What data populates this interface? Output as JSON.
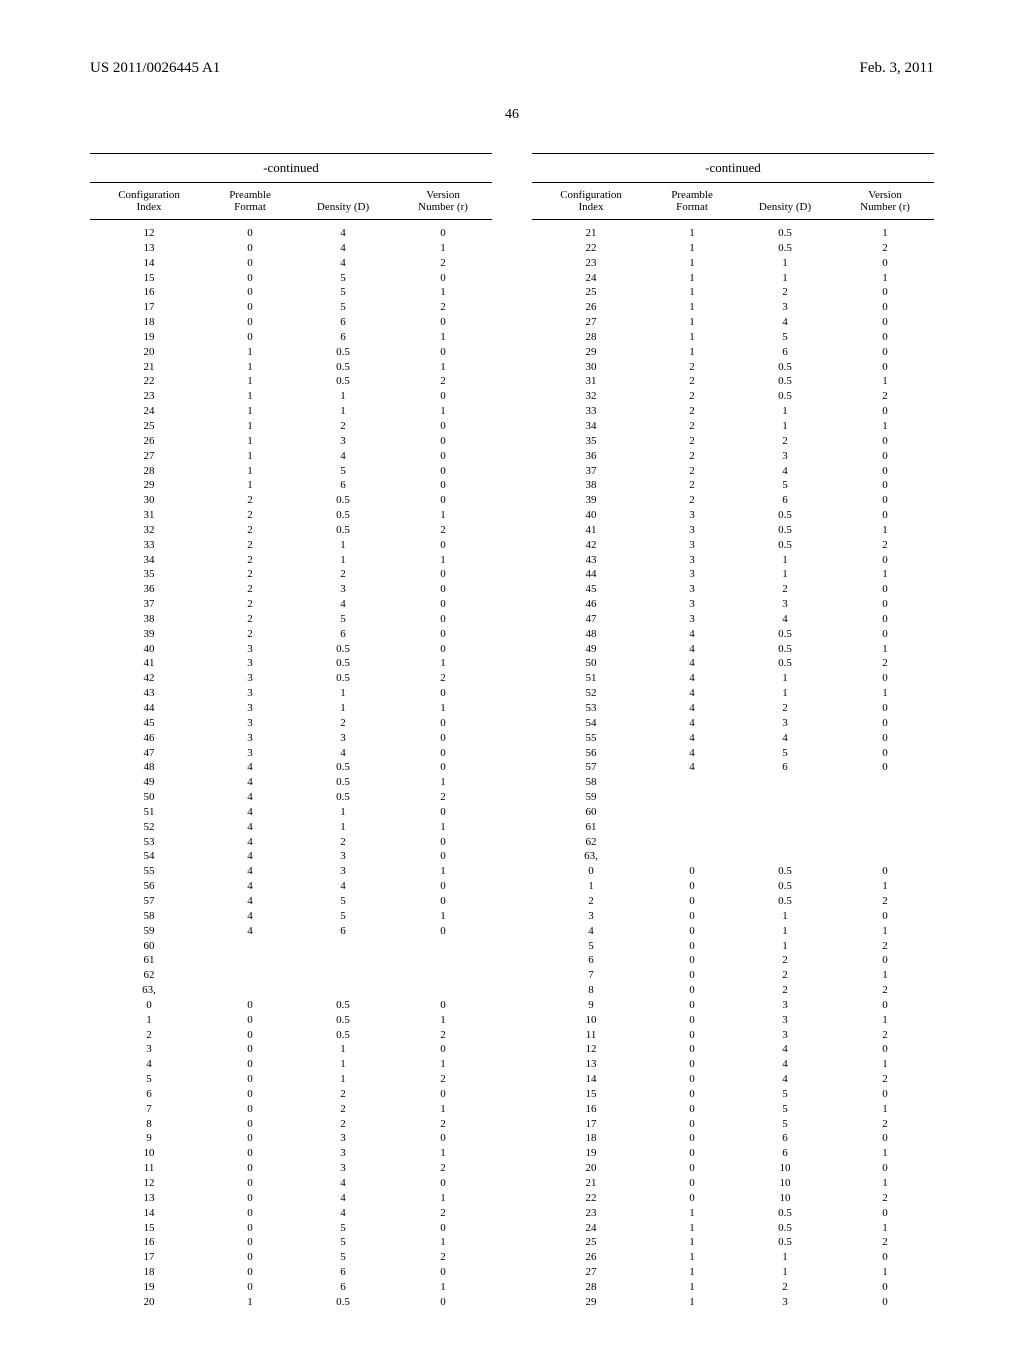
{
  "header": {
    "pub_number": "US 2011/0026445 A1",
    "date": "Feb. 3, 2011",
    "page": "46"
  },
  "table_headers": {
    "continued": "-continued",
    "cols": [
      "Configuration\nIndex",
      "Preamble\nFormat",
      "Density (D)",
      "Version\nNumber (r)"
    ]
  },
  "left_rows": [
    [
      "12",
      "0",
      "4",
      "0"
    ],
    [
      "13",
      "0",
      "4",
      "1"
    ],
    [
      "14",
      "0",
      "4",
      "2"
    ],
    [
      "15",
      "0",
      "5",
      "0"
    ],
    [
      "16",
      "0",
      "5",
      "1"
    ],
    [
      "17",
      "0",
      "5",
      "2"
    ],
    [
      "18",
      "0",
      "6",
      "0"
    ],
    [
      "19",
      "0",
      "6",
      "1"
    ],
    [
      "20",
      "1",
      "0.5",
      "0"
    ],
    [
      "21",
      "1",
      "0.5",
      "1"
    ],
    [
      "22",
      "1",
      "0.5",
      "2"
    ],
    [
      "23",
      "1",
      "1",
      "0"
    ],
    [
      "24",
      "1",
      "1",
      "1"
    ],
    [
      "25",
      "1",
      "2",
      "0"
    ],
    [
      "26",
      "1",
      "3",
      "0"
    ],
    [
      "27",
      "1",
      "4",
      "0"
    ],
    [
      "28",
      "1",
      "5",
      "0"
    ],
    [
      "29",
      "1",
      "6",
      "0"
    ],
    [
      "30",
      "2",
      "0.5",
      "0"
    ],
    [
      "31",
      "2",
      "0.5",
      "1"
    ],
    [
      "32",
      "2",
      "0.5",
      "2"
    ],
    [
      "33",
      "2",
      "1",
      "0"
    ],
    [
      "34",
      "2",
      "1",
      "1"
    ],
    [
      "35",
      "2",
      "2",
      "0"
    ],
    [
      "36",
      "2",
      "3",
      "0"
    ],
    [
      "37",
      "2",
      "4",
      "0"
    ],
    [
      "38",
      "2",
      "5",
      "0"
    ],
    [
      "39",
      "2",
      "6",
      "0"
    ],
    [
      "40",
      "3",
      "0.5",
      "0"
    ],
    [
      "41",
      "3",
      "0.5",
      "1"
    ],
    [
      "42",
      "3",
      "0.5",
      "2"
    ],
    [
      "43",
      "3",
      "1",
      "0"
    ],
    [
      "44",
      "3",
      "1",
      "1"
    ],
    [
      "45",
      "3",
      "2",
      "0"
    ],
    [
      "46",
      "3",
      "3",
      "0"
    ],
    [
      "47",
      "3",
      "4",
      "0"
    ],
    [
      "48",
      "4",
      "0.5",
      "0"
    ],
    [
      "49",
      "4",
      "0.5",
      "1"
    ],
    [
      "50",
      "4",
      "0.5",
      "2"
    ],
    [
      "51",
      "4",
      "1",
      "0"
    ],
    [
      "52",
      "4",
      "1",
      "1"
    ],
    [
      "53",
      "4",
      "2",
      "0"
    ],
    [
      "54",
      "4",
      "3",
      "0"
    ],
    [
      "55",
      "4",
      "3",
      "1"
    ],
    [
      "56",
      "4",
      "4",
      "0"
    ],
    [
      "57",
      "4",
      "5",
      "0"
    ],
    [
      "58",
      "4",
      "5",
      "1"
    ],
    [
      "59",
      "4",
      "6",
      "0"
    ],
    [
      "60",
      "",
      "",
      ""
    ],
    [
      "61",
      "",
      "",
      ""
    ],
    [
      "62",
      "",
      "",
      ""
    ],
    [
      "63,",
      "",
      "",
      ""
    ],
    [
      "0",
      "0",
      "0.5",
      "0"
    ],
    [
      "1",
      "0",
      "0.5",
      "1"
    ],
    [
      "2",
      "0",
      "0.5",
      "2"
    ],
    [
      "3",
      "0",
      "1",
      "0"
    ],
    [
      "4",
      "0",
      "1",
      "1"
    ],
    [
      "5",
      "0",
      "1",
      "2"
    ],
    [
      "6",
      "0",
      "2",
      "0"
    ],
    [
      "7",
      "0",
      "2",
      "1"
    ],
    [
      "8",
      "0",
      "2",
      "2"
    ],
    [
      "9",
      "0",
      "3",
      "0"
    ],
    [
      "10",
      "0",
      "3",
      "1"
    ],
    [
      "11",
      "0",
      "3",
      "2"
    ],
    [
      "12",
      "0",
      "4",
      "0"
    ],
    [
      "13",
      "0",
      "4",
      "1"
    ],
    [
      "14",
      "0",
      "4",
      "2"
    ],
    [
      "15",
      "0",
      "5",
      "0"
    ],
    [
      "16",
      "0",
      "5",
      "1"
    ],
    [
      "17",
      "0",
      "5",
      "2"
    ],
    [
      "18",
      "0",
      "6",
      "0"
    ],
    [
      "19",
      "0",
      "6",
      "1"
    ],
    [
      "20",
      "1",
      "0.5",
      "0"
    ]
  ],
  "right_rows": [
    [
      "21",
      "1",
      "0.5",
      "1"
    ],
    [
      "22",
      "1",
      "0.5",
      "2"
    ],
    [
      "23",
      "1",
      "1",
      "0"
    ],
    [
      "24",
      "1",
      "1",
      "1"
    ],
    [
      "25",
      "1",
      "2",
      "0"
    ],
    [
      "26",
      "1",
      "3",
      "0"
    ],
    [
      "27",
      "1",
      "4",
      "0"
    ],
    [
      "28",
      "1",
      "5",
      "0"
    ],
    [
      "29",
      "1",
      "6",
      "0"
    ],
    [
      "30",
      "2",
      "0.5",
      "0"
    ],
    [
      "31",
      "2",
      "0.5",
      "1"
    ],
    [
      "32",
      "2",
      "0.5",
      "2"
    ],
    [
      "33",
      "2",
      "1",
      "0"
    ],
    [
      "34",
      "2",
      "1",
      "1"
    ],
    [
      "35",
      "2",
      "2",
      "0"
    ],
    [
      "36",
      "2",
      "3",
      "0"
    ],
    [
      "37",
      "2",
      "4",
      "0"
    ],
    [
      "38",
      "2",
      "5",
      "0"
    ],
    [
      "39",
      "2",
      "6",
      "0"
    ],
    [
      "40",
      "3",
      "0.5",
      "0"
    ],
    [
      "41",
      "3",
      "0.5",
      "1"
    ],
    [
      "42",
      "3",
      "0.5",
      "2"
    ],
    [
      "43",
      "3",
      "1",
      "0"
    ],
    [
      "44",
      "3",
      "1",
      "1"
    ],
    [
      "45",
      "3",
      "2",
      "0"
    ],
    [
      "46",
      "3",
      "3",
      "0"
    ],
    [
      "47",
      "3",
      "4",
      "0"
    ],
    [
      "48",
      "4",
      "0.5",
      "0"
    ],
    [
      "49",
      "4",
      "0.5",
      "1"
    ],
    [
      "50",
      "4",
      "0.5",
      "2"
    ],
    [
      "51",
      "4",
      "1",
      "0"
    ],
    [
      "52",
      "4",
      "1",
      "1"
    ],
    [
      "53",
      "4",
      "2",
      "0"
    ],
    [
      "54",
      "4",
      "3",
      "0"
    ],
    [
      "55",
      "4",
      "4",
      "0"
    ],
    [
      "56",
      "4",
      "5",
      "0"
    ],
    [
      "57",
      "4",
      "6",
      "0"
    ],
    [
      "58",
      "",
      "",
      ""
    ],
    [
      "59",
      "",
      "",
      ""
    ],
    [
      "60",
      "",
      "",
      ""
    ],
    [
      "61",
      "",
      "",
      ""
    ],
    [
      "62",
      "",
      "",
      ""
    ],
    [
      "63,",
      "",
      "",
      ""
    ],
    [
      "0",
      "0",
      "0.5",
      "0"
    ],
    [
      "1",
      "0",
      "0.5",
      "1"
    ],
    [
      "2",
      "0",
      "0.5",
      "2"
    ],
    [
      "3",
      "0",
      "1",
      "0"
    ],
    [
      "4",
      "0",
      "1",
      "1"
    ],
    [
      "5",
      "0",
      "1",
      "2"
    ],
    [
      "6",
      "0",
      "2",
      "0"
    ],
    [
      "7",
      "0",
      "2",
      "1"
    ],
    [
      "8",
      "0",
      "2",
      "2"
    ],
    [
      "9",
      "0",
      "3",
      "0"
    ],
    [
      "10",
      "0",
      "3",
      "1"
    ],
    [
      "11",
      "0",
      "3",
      "2"
    ],
    [
      "12",
      "0",
      "4",
      "0"
    ],
    [
      "13",
      "0",
      "4",
      "1"
    ],
    [
      "14",
      "0",
      "4",
      "2"
    ],
    [
      "15",
      "0",
      "5",
      "0"
    ],
    [
      "16",
      "0",
      "5",
      "1"
    ],
    [
      "17",
      "0",
      "5",
      "2"
    ],
    [
      "18",
      "0",
      "6",
      "0"
    ],
    [
      "19",
      "0",
      "6",
      "1"
    ],
    [
      "20",
      "0",
      "10",
      "0"
    ],
    [
      "21",
      "0",
      "10",
      "1"
    ],
    [
      "22",
      "0",
      "10",
      "2"
    ],
    [
      "23",
      "1",
      "0.5",
      "0"
    ],
    [
      "24",
      "1",
      "0.5",
      "1"
    ],
    [
      "25",
      "1",
      "0.5",
      "2"
    ],
    [
      "26",
      "1",
      "1",
      "0"
    ],
    [
      "27",
      "1",
      "1",
      "1"
    ],
    [
      "28",
      "1",
      "2",
      "0"
    ],
    [
      "29",
      "1",
      "3",
      "0"
    ]
  ]
}
